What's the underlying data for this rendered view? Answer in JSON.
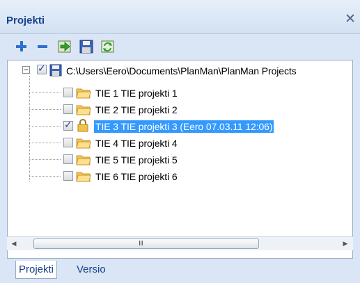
{
  "window": {
    "title": "Projekti",
    "close_label": "✕"
  },
  "toolbar": {
    "buttons": [
      {
        "name": "add",
        "icon": "plus-icon"
      },
      {
        "name": "remove",
        "icon": "minus-icon"
      },
      {
        "name": "open",
        "icon": "green-arrow-icon"
      },
      {
        "name": "save",
        "icon": "floppy-disk-icon"
      },
      {
        "name": "refresh",
        "icon": "refresh-icon"
      }
    ]
  },
  "tree": {
    "root": {
      "label": "C:\\Users\\Eero\\Documents\\PlanMan\\PlanMan Projects",
      "checked": true,
      "icon": "floppy-disk-icon"
    },
    "items": [
      {
        "label": "TIE 1  TIE projekti 1",
        "checked": false,
        "icon": "folder-icon",
        "selected": false
      },
      {
        "label": "TIE 2  TIE projekti 2",
        "checked": false,
        "icon": "folder-icon",
        "selected": false
      },
      {
        "label": "TIE 3  TIE projekti 3 (Eero 07.03.11 12:06)",
        "checked": true,
        "icon": "lock-icon",
        "selected": true
      },
      {
        "label": "TIE 4  TIE projekti 4",
        "checked": false,
        "icon": "folder-icon",
        "selected": false
      },
      {
        "label": "TIE 5  TIE projekti 5",
        "checked": false,
        "icon": "folder-icon",
        "selected": false
      },
      {
        "label": "TIE 6  TIE projekti 6",
        "checked": false,
        "icon": "folder-icon",
        "selected": false
      }
    ]
  },
  "scrollbar": {
    "left_arrow": "◀",
    "right_arrow": "▶",
    "grip": "III"
  },
  "tabs": [
    {
      "label": "Projekti",
      "active": true
    },
    {
      "label": "Versio",
      "active": false
    }
  ],
  "colors": {
    "selection": "#3399ff",
    "title_text": "#15428b",
    "panel_bg": "#dae6f5"
  }
}
